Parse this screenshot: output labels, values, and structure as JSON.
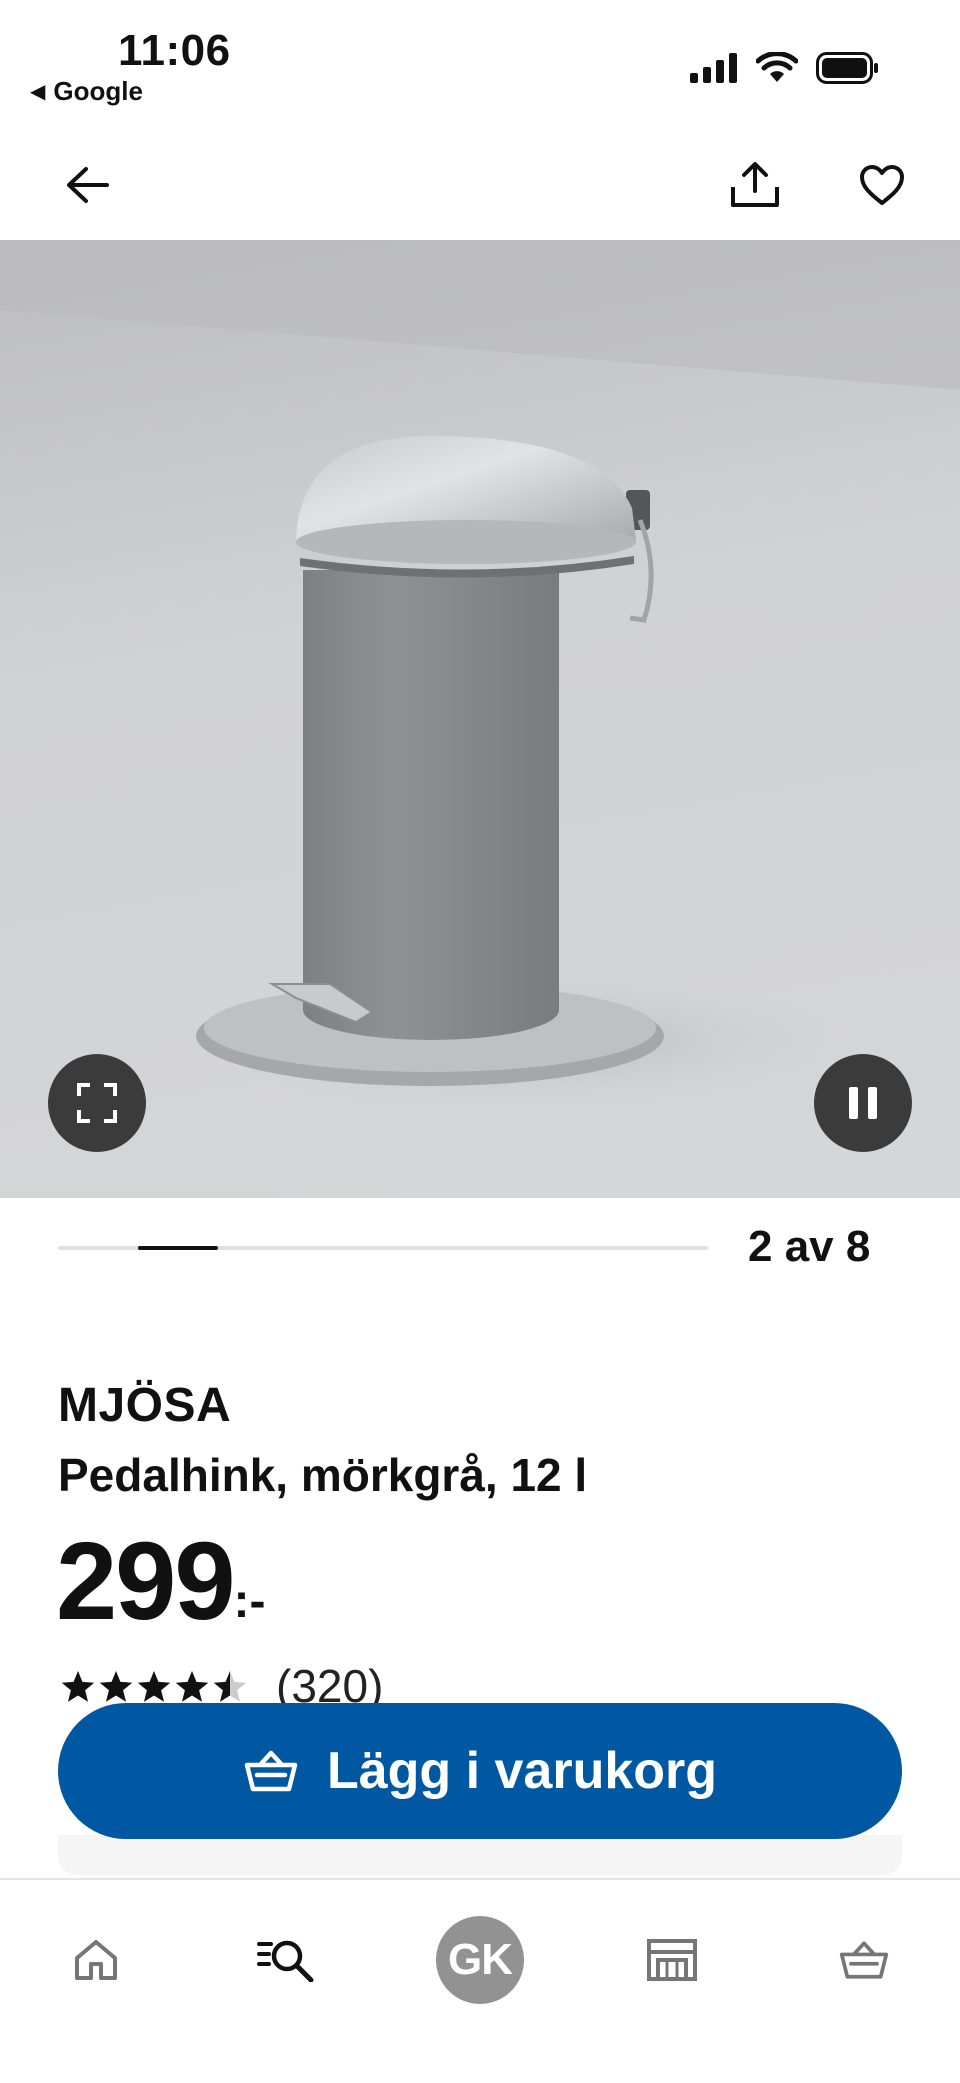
{
  "status_bar": {
    "time": "11:06",
    "back_app": "Google",
    "icons": [
      "signal-icon",
      "wifi-icon",
      "battery-icon"
    ]
  },
  "header": {
    "icons": [
      "arrow-left-icon",
      "share-icon",
      "heart-icon"
    ]
  },
  "media": {
    "pager_text": "2 av 8",
    "current": 2,
    "total": 8,
    "controls": [
      "fullscreen-icon",
      "pause-icon"
    ]
  },
  "product": {
    "brand": "MJÖSA",
    "subtitle": "Pedalhink, mörkgrå, 12 l",
    "price_number": "299",
    "price_suffix": ":-",
    "rating_value": 4.5,
    "rating_count": "(320)"
  },
  "cta": {
    "label": "Lägg i varukorg"
  },
  "bottom_nav": {
    "items": [
      "home-icon",
      "search-list-icon",
      "profile-avatar",
      "store-icon",
      "basket-icon"
    ],
    "avatar_initials": "GK"
  },
  "colors": {
    "brand_blue": "#0058a3",
    "background": "#ffffff",
    "control_dark": "#3b3b3b"
  }
}
